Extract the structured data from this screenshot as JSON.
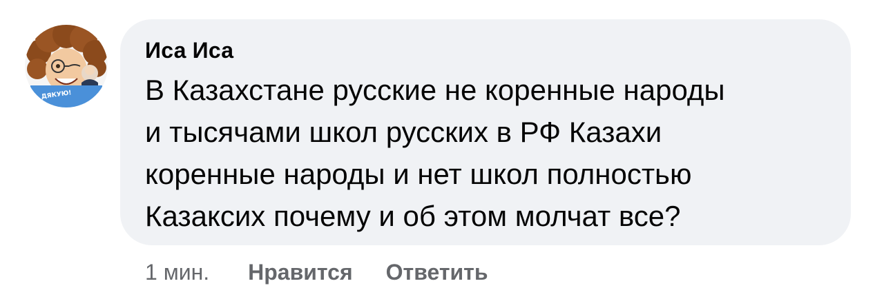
{
  "comment": {
    "author": "Иса Иса",
    "text_lines": [
      "В Казахстане русские не коренные народы",
      "и тысячами школ русских в РФ Казахи",
      "коренные народы и нет школ полностью",
      "Казаксих почему и об этом молчат все?"
    ],
    "avatar": {
      "icon": "user-avatar",
      "sticker_label": "ДЯКУЮ!"
    }
  },
  "actions": {
    "time": "1 мин.",
    "like_label": "Нравится",
    "reply_label": "Ответить"
  },
  "colors": {
    "bubble_bg": "#f0f2f5",
    "text": "#050505",
    "meta_text": "#65676b",
    "sticker_banner": "#4a90d9"
  }
}
